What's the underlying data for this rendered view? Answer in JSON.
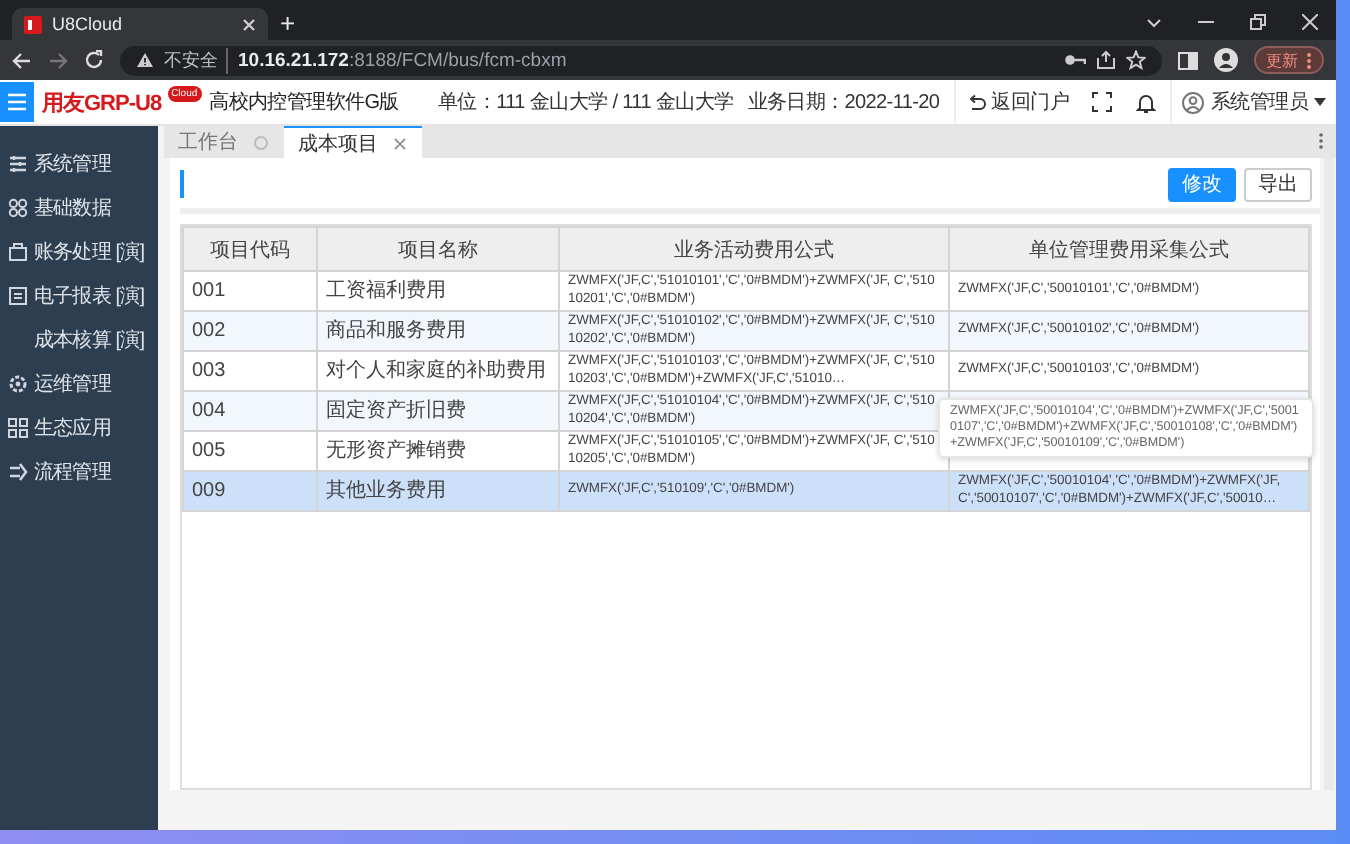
{
  "browser": {
    "tab_title": "U8Cloud",
    "new_tab": "+",
    "insecure_label": "不安全",
    "url_host": "10.16.21.172",
    "url_rest": ":8188/FCM/bus/fcm-cbxm",
    "update_button": "更新"
  },
  "header": {
    "logo": "用友GRP-U8",
    "logo_badge": "Cloud",
    "product": "高校内控管理软件G版",
    "unit": "单位：111 金山大学 / 111 金山大学",
    "date": "业务日期：2022-11-20",
    "portal": "返回门户",
    "user": "系统管理员"
  },
  "sidebar": {
    "items": [
      {
        "label": "系统管理",
        "kind": "module"
      },
      {
        "label": "基础数据",
        "kind": "module"
      },
      {
        "label": "账务处理",
        "tag": "[演]",
        "kind": "module"
      },
      {
        "label": "电子报表",
        "tag": "[演]",
        "kind": "module"
      },
      {
        "label": "成本核算",
        "tag": "[演]",
        "kind": "subitem"
      },
      {
        "label": "运维管理",
        "kind": "module"
      },
      {
        "label": "生态应用",
        "kind": "module"
      },
      {
        "label": "流程管理",
        "kind": "module"
      }
    ]
  },
  "tabs": [
    {
      "label": "工作台",
      "selected": false
    },
    {
      "label": "成本项目",
      "selected": true
    }
  ],
  "toolbar": {
    "buttons": [
      {
        "label": "修改",
        "kind": "primary"
      },
      {
        "label": "导出",
        "kind": "default"
      }
    ]
  },
  "table": {
    "columns": [
      "项目代码",
      "项目名称",
      "业务活动费用公式",
      "单位管理费用采集公式"
    ],
    "rows": [
      {
        "selected": false,
        "cells": [
          "001",
          "工资福利费用",
          "ZWMFX('JF,C','51010101','C','0#BMDM')+ZWMFX('JF, C','51010201','C','0#BMDM')",
          "ZWMFX('JF,C','50010101','C','0#BMDM')"
        ]
      },
      {
        "selected": false,
        "cells": [
          "002",
          "商品和服务费用",
          "ZWMFX('JF,C','51010102','C','0#BMDM')+ZWMFX('JF, C','51010202','C','0#BMDM')",
          "ZWMFX('JF,C','50010102','C','0#BMDM')"
        ]
      },
      {
        "selected": false,
        "cells": [
          "003",
          "对个人和家庭的补助费用",
          "ZWMFX('JF,C','51010103','C','0#BMDM')+ZWMFX('JF, C','51010203','C','0#BMDM')+ZWMFX('JF,C','51010…",
          "ZWMFX('JF,C','50010103','C','0#BMDM')"
        ]
      },
      {
        "selected": false,
        "cells": [
          "004",
          "固定资产折旧费",
          "ZWMFX('JF,C','51010104','C','0#BMDM')+ZWMFX('JF, C','51010204','C','0#BMDM')"
        ]
      },
      {
        "selected": false,
        "cells": [
          "005",
          "无形资产摊销费",
          "ZWMFX('JF,C','51010105','C','0#BMDM')+ZWMFX('JF, C','51010205','C','0#BMDM')"
        ]
      },
      {
        "selected": true,
        "cells": [
          "009",
          "其他业务费用",
          "ZWMFX('JF,C','510109','C','0#BMDM')",
          "ZWMFX('JF,C','50010104','C','0#BMDM')+ZWMFX('JF, C','50010107','C','0#BMDM')+ZWMFX('JF,C','50010…"
        ]
      }
    ]
  },
  "tooltip": {
    "text": "ZWMFX('JF,C','50010104','C','0#BMDM')+ZWMFX('JF,C','50010107','C','0#BMDM')+ZWMFX('JF,C','50010108','C','0#BMDM')+ZWMFX('JF,C','50010109','C','0#BMDM')"
  }
}
